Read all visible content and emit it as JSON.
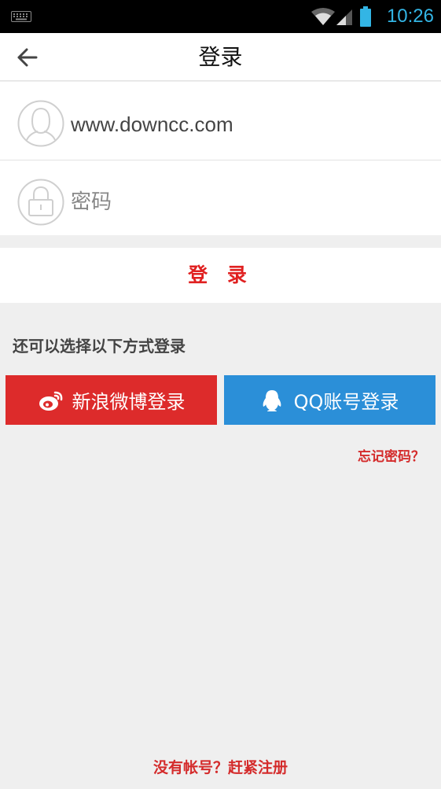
{
  "status_bar": {
    "time": "10:26",
    "icons": [
      "keyboard-icon",
      "wifi-icon",
      "signal-icon",
      "battery-icon"
    ],
    "time_color": "#33b5e5"
  },
  "header": {
    "title": "登录",
    "back_icon": "back-arrow-icon"
  },
  "form": {
    "username": {
      "value": "www.downcc.com",
      "icon": "user-avatar-icon"
    },
    "password": {
      "placeholder": "密码",
      "icon": "lock-icon"
    },
    "login_label": "登 录"
  },
  "alt_login": {
    "label": "还可以选择以下方式登录",
    "weibo": {
      "label": "新浪微博登录",
      "icon": "weibo-icon",
      "color": "#dd2b2b"
    },
    "qq": {
      "label": "QQ账号登录",
      "icon": "qq-penguin-icon",
      "color": "#2b8fd8"
    }
  },
  "links": {
    "forgot": "忘记密码？",
    "register": "没有帐号？赶紧注册"
  },
  "colors": {
    "accent_red": "#e02020",
    "background": "#efefef"
  }
}
